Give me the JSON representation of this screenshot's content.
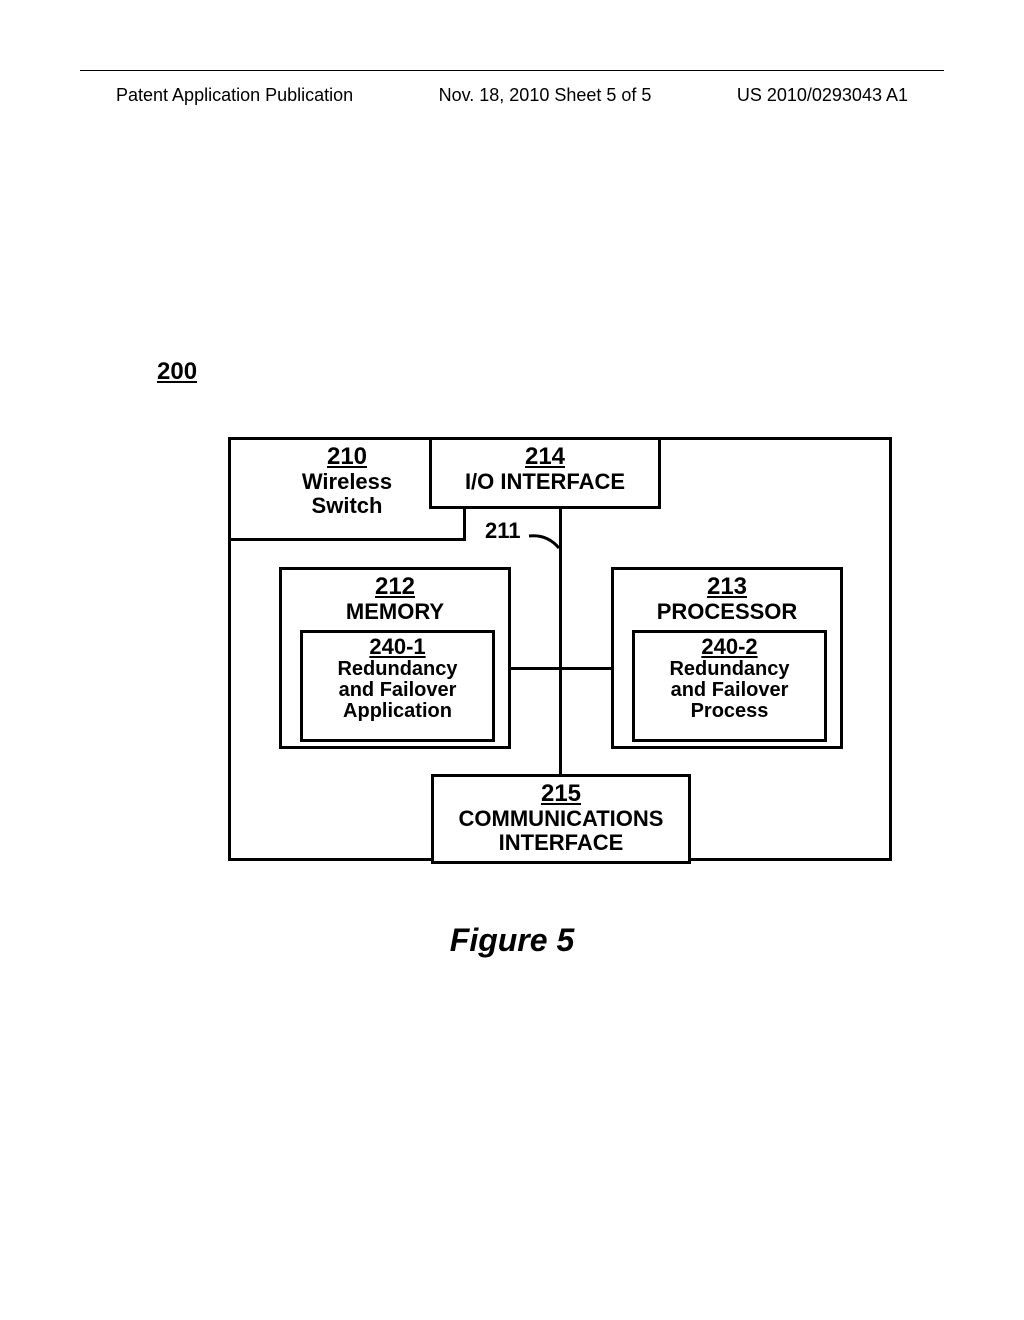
{
  "header": {
    "left": "Patent Application Publication",
    "center": "Nov. 18, 2010  Sheet 5 of 5",
    "right": "US 2010/0293043 A1"
  },
  "ref200": "200",
  "blocks": {
    "b210": {
      "ref": "210",
      "l1": "Wireless",
      "l2": "Switch"
    },
    "b214": {
      "ref": "214",
      "l1": "I/O INTERFACE"
    },
    "b211_label": "211",
    "b212": {
      "ref": "212",
      "l1": "MEMORY"
    },
    "b240_1": {
      "ref": "240-1",
      "l1": "Redundancy",
      "l2": "and Failover",
      "l3": "Application"
    },
    "b213": {
      "ref": "213",
      "l1": "PROCESSOR"
    },
    "b240_2": {
      "ref": "240-2",
      "l1": "Redundancy",
      "l2": "and Failover",
      "l3": "Process"
    },
    "b215": {
      "ref": "215",
      "l1": "COMMUNICATIONS",
      "l2": "INTERFACE"
    }
  },
  "caption": "Figure 5"
}
